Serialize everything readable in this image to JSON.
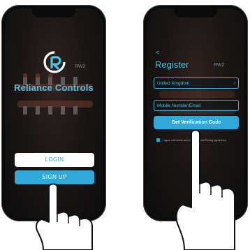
{
  "login_screen": {
    "brand_name": "Reliance Controls",
    "login_label": "LOGIN",
    "signup_label": "SIGN UP",
    "badge": "RW2"
  },
  "register_screen": {
    "back_glyph": "<",
    "title": "Register",
    "country_value": "United Kingdom",
    "mobile_placeholder": "Mobile Number/Email",
    "verify_label": "Get Verification Code",
    "terms_text": "I agree with terms and conditions and Privacy agreement",
    "badge": "RW2"
  },
  "colors": {
    "accent": "#2fa9da",
    "brand_text": "#4fc0e6"
  },
  "icons": [
    "reliance-logo-icon",
    "chevron-down-icon",
    "checkbox-icon",
    "hand-pointer-icon"
  ]
}
